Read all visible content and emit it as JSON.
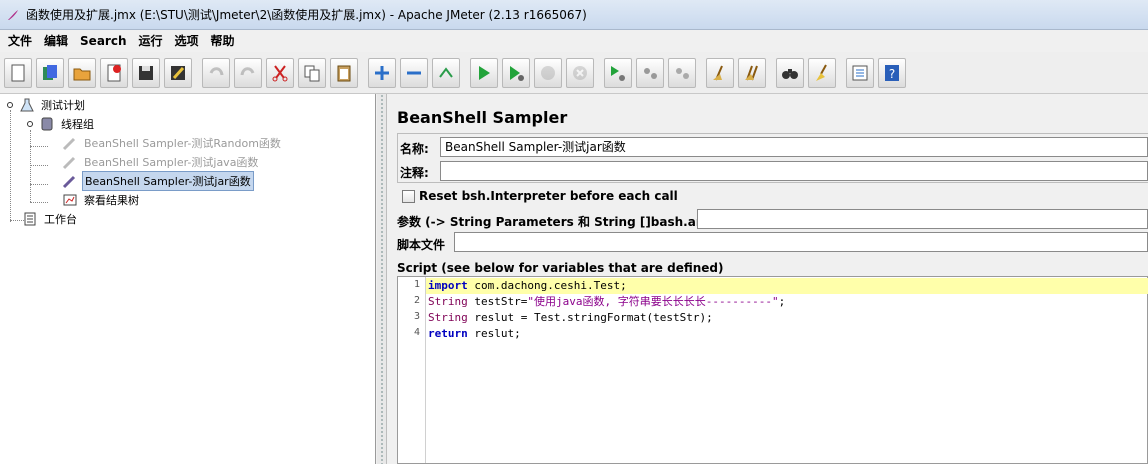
{
  "window": {
    "title": "函数使用及扩展.jmx (E:\\STU\\测试\\Jmeter\\2\\函数使用及扩展.jmx) - Apache JMeter (2.13 r1665067)"
  },
  "menu": [
    "文件",
    "编辑",
    "Search",
    "运行",
    "选项",
    "帮助"
  ],
  "toolbar": [
    {
      "name": "new-icon"
    },
    {
      "name": "templates-icon"
    },
    {
      "name": "open-icon"
    },
    {
      "name": "close-icon"
    },
    {
      "name": "save-icon"
    },
    {
      "name": "save-as-icon"
    },
    {
      "name": "undo-icon"
    },
    {
      "name": "redo-icon"
    },
    {
      "name": "cut-icon"
    },
    {
      "name": "copy-icon"
    },
    {
      "name": "paste-icon"
    },
    {
      "name": "expand-icon"
    },
    {
      "name": "collapse-icon"
    },
    {
      "name": "toggle-icon"
    },
    {
      "name": "start-icon"
    },
    {
      "name": "start-no-pause-icon"
    },
    {
      "name": "stop-icon"
    },
    {
      "name": "shutdown-icon"
    },
    {
      "name": "remote-start-icon"
    },
    {
      "name": "remote-stop-icon"
    },
    {
      "name": "remote-shutdown-icon"
    },
    {
      "name": "clear-icon"
    },
    {
      "name": "clear-all-icon"
    },
    {
      "name": "search-icon"
    },
    {
      "name": "reset-search-icon"
    },
    {
      "name": "function-helper-icon"
    },
    {
      "name": "help-icon"
    }
  ],
  "tree": {
    "test_plan": "测试计划",
    "thread_group": "线程组",
    "sampler_random": "BeanShell Sampler-测试Random函数",
    "sampler_java": "BeanShell Sampler-测试java函数",
    "sampler_jar": "BeanShell Sampler-测试jar函数",
    "result_tree": "察看结果树",
    "workbench": "工作台"
  },
  "panel": {
    "title": "BeanShell Sampler",
    "name_label": "名称:",
    "name_value": "BeanShell Sampler-测试jar函数",
    "comment_label": "注释:",
    "comment_value": "",
    "reset_label": "Reset bsh.Interpreter before each call",
    "reset_checked": false,
    "params_label": "参数 (-> String Parameters 和 String []bash.args)",
    "params_value": "",
    "script_file_label": "脚本文件",
    "script_file_value": "",
    "script_label": "Script (see below for variables that are defined)"
  },
  "script": {
    "line_numbers": [
      "1",
      "2",
      "3",
      "4"
    ],
    "lines": [
      {
        "kw": "import",
        "rest": " com.dachong.ceshi.Test;"
      },
      {
        "ty": "String",
        "rest": " testStr=",
        "str": "\"使用java函数, 字符串要长长长长----------\"",
        "tail": ";"
      },
      {
        "ty": "String",
        "rest": " reslut = Test.stringFormat(testStr);"
      },
      {
        "kw": "return",
        "rest": " reslut;"
      }
    ]
  },
  "colors": {
    "accent": "#c5d7ee",
    "current_line": "#ffffaa",
    "keyword": "#0000c0",
    "string": "#8b008b"
  }
}
